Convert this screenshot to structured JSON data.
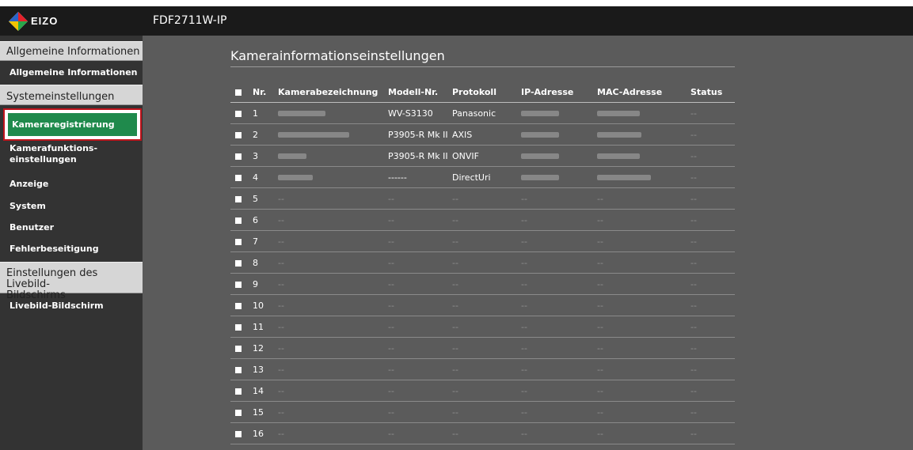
{
  "header": {
    "logo_text": "EIZO",
    "model": "FDF2711W-IP"
  },
  "sidebar": {
    "sections": [
      {
        "title": "Allgemeine Informationen",
        "items": [
          "Allgemeine Informationen"
        ]
      },
      {
        "title": "Systemeinstellungen",
        "items": [
          "Kameraregistrierung",
          "Kamerafunktions-\neinstellungen",
          "Anzeige",
          "System",
          "Benutzer",
          "Fehlerbeseitigung"
        ]
      },
      {
        "title": "Einstellungen des Livebild-\nBildschirms",
        "items": [
          "Livebild-Bildschirm"
        ]
      }
    ],
    "active_item": "Kameraregistrierung"
  },
  "main": {
    "title": "Kamerainformationseinstellungen",
    "columns": [
      "Nr.",
      "Kamerabezeichnung",
      "Modell-Nr.",
      "Protokoll",
      "IP-Adresse",
      "MAC-Adresse",
      "Status"
    ],
    "rows": [
      {
        "nr": "1",
        "name": "",
        "model": "WV-S3130",
        "protocol": "Panasonic",
        "ip": "",
        "mac": "",
        "status": "--"
      },
      {
        "nr": "2",
        "name": "",
        "model": "P3905-R Mk II",
        "protocol": "AXIS",
        "ip": "",
        "mac": "",
        "status": "--"
      },
      {
        "nr": "3",
        "name": "",
        "model": "P3905-R Mk II",
        "protocol": "ONVIF",
        "ip": "",
        "mac": "",
        "status": "--"
      },
      {
        "nr": "4",
        "name": "",
        "model": "------",
        "protocol": "DirectUri",
        "ip": "",
        "mac": "",
        "status": "--"
      },
      {
        "nr": "5",
        "name": "--",
        "model": "--",
        "protocol": "--",
        "ip": "--",
        "mac": "--",
        "status": "--"
      },
      {
        "nr": "6",
        "name": "--",
        "model": "--",
        "protocol": "--",
        "ip": "--",
        "mac": "--",
        "status": "--"
      },
      {
        "nr": "7",
        "name": "--",
        "model": "--",
        "protocol": "--",
        "ip": "--",
        "mac": "--",
        "status": "--"
      },
      {
        "nr": "8",
        "name": "--",
        "model": "--",
        "protocol": "--",
        "ip": "--",
        "mac": "--",
        "status": "--"
      },
      {
        "nr": "9",
        "name": "--",
        "model": "--",
        "protocol": "--",
        "ip": "--",
        "mac": "--",
        "status": "--"
      },
      {
        "nr": "10",
        "name": "--",
        "model": "--",
        "protocol": "--",
        "ip": "--",
        "mac": "--",
        "status": "--"
      },
      {
        "nr": "11",
        "name": "--",
        "model": "--",
        "protocol": "--",
        "ip": "--",
        "mac": "--",
        "status": "--"
      },
      {
        "nr": "12",
        "name": "--",
        "model": "--",
        "protocol": "--",
        "ip": "--",
        "mac": "--",
        "status": "--"
      },
      {
        "nr": "13",
        "name": "--",
        "model": "--",
        "protocol": "--",
        "ip": "--",
        "mac": "--",
        "status": "--"
      },
      {
        "nr": "14",
        "name": "--",
        "model": "--",
        "protocol": "--",
        "ip": "--",
        "mac": "--",
        "status": "--"
      },
      {
        "nr": "15",
        "name": "--",
        "model": "--",
        "protocol": "--",
        "ip": "--",
        "mac": "--",
        "status": "--"
      },
      {
        "nr": "16",
        "name": "--",
        "model": "--",
        "protocol": "--",
        "ip": "--",
        "mac": "--",
        "status": "--"
      }
    ]
  },
  "colors": {
    "active_green": "#1f8a4c",
    "highlight_red": "#c0141c",
    "background": "#5b5b5b"
  }
}
